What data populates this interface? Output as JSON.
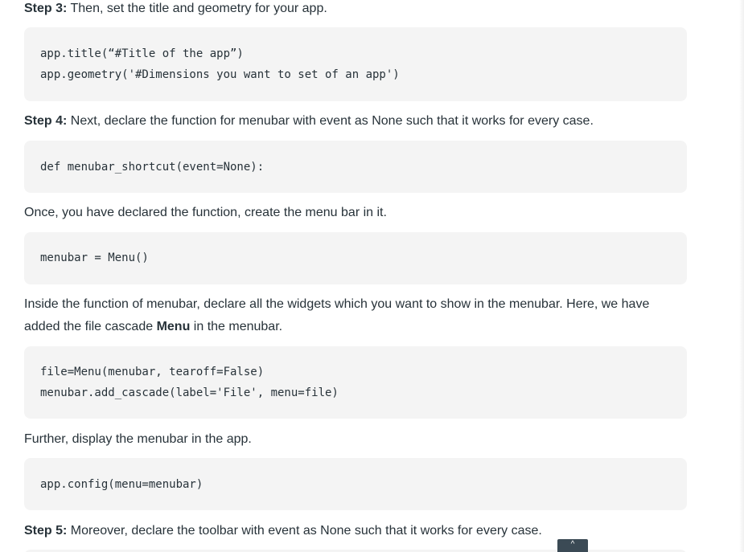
{
  "steps": {
    "step3_label": "Step 3:",
    "step3_text": " Then, set the title and geometry for your app.",
    "code1": [
      "app.title(“#Title of the app”)",
      "app.geometry('#Dimensions you want to set of an app')"
    ],
    "step4_label": "Step 4:",
    "step4_text": " Next, declare the function for menubar with event as None such that it works for every case.",
    "code2": [
      "def menubar_shortcut(event=None):"
    ],
    "para_declared": "Once, you have declared the function, create the menu bar in it.",
    "code3": [
      "menubar = Menu()"
    ],
    "para_inside_before": "Inside the function of menubar, declare all the widgets which you want to show in the menubar. Here, we have added the file cascade ",
    "para_inside_bold": "Menu",
    "para_inside_after": " in the menubar.",
    "code4": [
      "file=Menu(menubar, tearoff=False)",
      "menubar.add_cascade(label='File', menu=file)"
    ],
    "para_further": "Further, display the menubar in the app.",
    "code5": [
      "app.config(menu=menubar)"
    ],
    "step5_label": "Step 5:",
    "step5_text": " Moreover, declare the toolbar with event as None such that it works for every case."
  },
  "scroll_top_icon": "chevron-up-icon",
  "scroll_top_glyph": "^"
}
